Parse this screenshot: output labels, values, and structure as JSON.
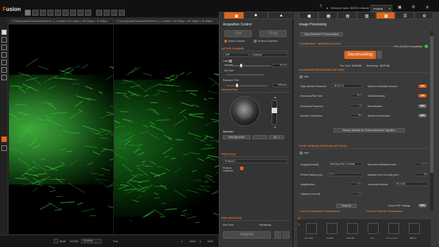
{
  "app": {
    "name_prefix": "F",
    "name_rest": "usion"
  },
  "topbar": {
    "account": "Welcome back, BIO2D Cellpath",
    "mode": "Imaging",
    "icons": [
      "help-icon",
      "user-icon",
      "monitor-icon",
      "settings-icon",
      "close-icon"
    ]
  },
  "viewers": [
    {
      "tab": "C:\\Users\\g.addo\\Documents\\Fusion\\1_0_1 scroller4   115.126μm × 115.126μm × 31.326μm"
    },
    {
      "tab": "C:\\Users\\g.addo\\Documents\\Fusion\\1_0_1 scroller4   115.126μm × 115.126μm × 31.326μm"
    }
  ],
  "statusbar": {
    "mode_label": "Multi",
    "zoom_label": "ZOOM",
    "zoom_value": "76 (50%)",
    "pos_label": "Pos",
    "x_label": "x",
    "x_value": "1024",
    "y_label": "y",
    "y_value": "1024"
  },
  "acquisition": {
    "title": "Acquisition Control",
    "live": "Live",
    "snap": "Snap",
    "active_channel": "Active Channel",
    "protocol_channels": "Protocol Channels",
    "active_channel_section": "ACTIVE CHANNEL",
    "channel": "GFP",
    "channel_mode": "Confocal",
    "laser_label": "Laser",
    "intensity_label": "Intensity",
    "intensity_value": "5.0 %",
    "intensity_pct": 20,
    "gain_label": "DH Gain",
    "exposure_label": "Exposure Time",
    "exposure_value": "200 ms",
    "exposure_pct": 25,
    "navigation": "NAVIGATION",
    "specimen_label": "Specimen",
    "new_specimen": "New Specimen",
    "specimen_no": "No. 1",
    "protocol_section": "PROTOCOL",
    "protocol_value": "Protocol 1",
    "protocol_channels_label": "Protocol Channels",
    "run_protocol": "RUN PROTOCOL",
    "run_time": "Run Time:",
    "remaining": "Remaining:",
    "acquire": "Acquire"
  },
  "processing": {
    "title": "Image Processing",
    "help_button": "Help ClearView™ Deconvolution",
    "clearview_section": "CLEARVIEW™ DECONVOLUTION",
    "gpu": "GPU (CUDA) Compatibility",
    "deconvolving": "Deconvolving",
    "run_time_label": "Run Time:",
    "run_time_value": "00:04:33",
    "remaining_label": "Remaining:",
    "remaining_value": "00:07:28",
    "advanced_section": "ADVANCED PROCESSING OPTIONS",
    "hide": "Hide",
    "edge_label": "Edge Artefact Reduction",
    "edge_value": "All (XYZ)",
    "min_intensity": "Minimum Intensity Removal",
    "denoising_size": "Denoising Filter Size",
    "denoising_size_value": "0.7",
    "initial_denoising": "Initial Denoising",
    "denoising_freq": "Denoising Frequency",
    "denoising_freq_value": "4",
    "normalization": "Normalization",
    "iterations": "Number of Iterations",
    "iterations_value": "20",
    "iteration_accel": "Iteration Acceleration",
    "restore": "Restore Defaults for \"Robust (Iterative)\" algorithm",
    "psf_section": "POINT SPREAD FUNCTION SETTINGS",
    "imaging_modality": "Imaging Modality",
    "imaging_modality_value": "Spinning Disk Confocal",
    "specimen_ri": "Specimen Refractive Index",
    "specimen_ri_value": "1.333",
    "pinhole": "Pinhole Radius (μm)",
    "pinhole_value": "40.0",
    "distance_coverslip": "Distance from Coverslip (μm)",
    "distance_coverslip_value": "20",
    "magnification": "Magnification",
    "magnification_value": "100",
    "immersion": "Immersion Medium",
    "immersion_value": "Oil (1.52)",
    "objective_na": "Objective Lens NA",
    "objective_na_value": "1.4",
    "reset_all": "Reset All",
    "unlock_psf": "Unlock PSF Settings",
    "on": "ON",
    "off": "OFF",
    "current_calibration": "Current Calibration Information",
    "current_channel": "Current Channel Information",
    "thumbs": [
      "ALC-1111",
      "E-1383",
      "CSU-W1",
      "Left",
      "0 mm, 0 mm",
      "488 nm"
    ]
  }
}
